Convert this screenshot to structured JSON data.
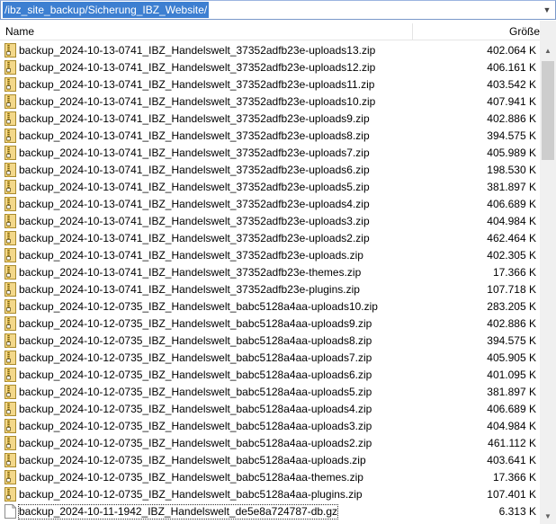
{
  "address": {
    "path": "/ibz_site_backup/Sicherung_IBZ_Website/"
  },
  "columns": {
    "name": "Name",
    "size": "Größe"
  },
  "files": [
    {
      "name": "backup_2024-10-13-0741_IBZ_Handelswelt_37352adfb23e-uploads13.zip",
      "size": "402.064 K",
      "type": "zip"
    },
    {
      "name": "backup_2024-10-13-0741_IBZ_Handelswelt_37352adfb23e-uploads12.zip",
      "size": "406.161 K",
      "type": "zip"
    },
    {
      "name": "backup_2024-10-13-0741_IBZ_Handelswelt_37352adfb23e-uploads11.zip",
      "size": "403.542 K",
      "type": "zip"
    },
    {
      "name": "backup_2024-10-13-0741_IBZ_Handelswelt_37352adfb23e-uploads10.zip",
      "size": "407.941 K",
      "type": "zip"
    },
    {
      "name": "backup_2024-10-13-0741_IBZ_Handelswelt_37352adfb23e-uploads9.zip",
      "size": "402.886 K",
      "type": "zip"
    },
    {
      "name": "backup_2024-10-13-0741_IBZ_Handelswelt_37352adfb23e-uploads8.zip",
      "size": "394.575 K",
      "type": "zip"
    },
    {
      "name": "backup_2024-10-13-0741_IBZ_Handelswelt_37352adfb23e-uploads7.zip",
      "size": "405.989 K",
      "type": "zip"
    },
    {
      "name": "backup_2024-10-13-0741_IBZ_Handelswelt_37352adfb23e-uploads6.zip",
      "size": "198.530 K",
      "type": "zip"
    },
    {
      "name": "backup_2024-10-13-0741_IBZ_Handelswelt_37352adfb23e-uploads5.zip",
      "size": "381.897 K",
      "type": "zip"
    },
    {
      "name": "backup_2024-10-13-0741_IBZ_Handelswelt_37352adfb23e-uploads4.zip",
      "size": "406.689 K",
      "type": "zip"
    },
    {
      "name": "backup_2024-10-13-0741_IBZ_Handelswelt_37352adfb23e-uploads3.zip",
      "size": "404.984 K",
      "type": "zip"
    },
    {
      "name": "backup_2024-10-13-0741_IBZ_Handelswelt_37352adfb23e-uploads2.zip",
      "size": "462.464 K",
      "type": "zip"
    },
    {
      "name": "backup_2024-10-13-0741_IBZ_Handelswelt_37352adfb23e-uploads.zip",
      "size": "402.305 K",
      "type": "zip"
    },
    {
      "name": "backup_2024-10-13-0741_IBZ_Handelswelt_37352adfb23e-themes.zip",
      "size": "17.366 K",
      "type": "zip"
    },
    {
      "name": "backup_2024-10-13-0741_IBZ_Handelswelt_37352adfb23e-plugins.zip",
      "size": "107.718 K",
      "type": "zip"
    },
    {
      "name": "backup_2024-10-12-0735_IBZ_Handelswelt_babc5128a4aa-uploads10.zip",
      "size": "283.205 K",
      "type": "zip"
    },
    {
      "name": "backup_2024-10-12-0735_IBZ_Handelswelt_babc5128a4aa-uploads9.zip",
      "size": "402.886 K",
      "type": "zip"
    },
    {
      "name": "backup_2024-10-12-0735_IBZ_Handelswelt_babc5128a4aa-uploads8.zip",
      "size": "394.575 K",
      "type": "zip"
    },
    {
      "name": "backup_2024-10-12-0735_IBZ_Handelswelt_babc5128a4aa-uploads7.zip",
      "size": "405.905 K",
      "type": "zip"
    },
    {
      "name": "backup_2024-10-12-0735_IBZ_Handelswelt_babc5128a4aa-uploads6.zip",
      "size": "401.095 K",
      "type": "zip"
    },
    {
      "name": "backup_2024-10-12-0735_IBZ_Handelswelt_babc5128a4aa-uploads5.zip",
      "size": "381.897 K",
      "type": "zip"
    },
    {
      "name": "backup_2024-10-12-0735_IBZ_Handelswelt_babc5128a4aa-uploads4.zip",
      "size": "406.689 K",
      "type": "zip"
    },
    {
      "name": "backup_2024-10-12-0735_IBZ_Handelswelt_babc5128a4aa-uploads3.zip",
      "size": "404.984 K",
      "type": "zip"
    },
    {
      "name": "backup_2024-10-12-0735_IBZ_Handelswelt_babc5128a4aa-uploads2.zip",
      "size": "461.112 K",
      "type": "zip"
    },
    {
      "name": "backup_2024-10-12-0735_IBZ_Handelswelt_babc5128a4aa-uploads.zip",
      "size": "403.641 K",
      "type": "zip"
    },
    {
      "name": "backup_2024-10-12-0735_IBZ_Handelswelt_babc5128a4aa-themes.zip",
      "size": "17.366 K",
      "type": "zip"
    },
    {
      "name": "backup_2024-10-12-0735_IBZ_Handelswelt_babc5128a4aa-plugins.zip",
      "size": "107.401 K",
      "type": "zip"
    },
    {
      "name": "backup_2024-10-11-1942_IBZ_Handelswelt_de5e8a724787-db.gz",
      "size": "6.313 K",
      "type": "gz",
      "selected": true
    }
  ],
  "icons": {
    "zip": "zip-file-icon",
    "gz": "generic-file-icon"
  },
  "colors": {
    "selection": "#3d7fd1",
    "zip_folder": "#e8c76a"
  }
}
